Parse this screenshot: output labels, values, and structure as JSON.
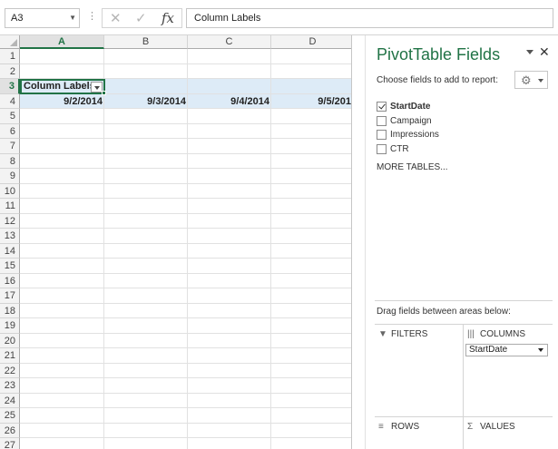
{
  "formula_bar": {
    "name_box": "A3",
    "dots": "⋮",
    "cancel_glyph": "✕",
    "enter_glyph": "✓",
    "fx_glyph": "fx",
    "formula": "Column Labels"
  },
  "grid": {
    "columns": [
      "A",
      "B",
      "C",
      "D"
    ],
    "rows": [
      "1",
      "2",
      "3",
      "4",
      "5",
      "6",
      "7",
      "8",
      "9",
      "10",
      "11",
      "12",
      "13",
      "14",
      "15",
      "16",
      "17",
      "18",
      "19",
      "20",
      "21",
      "22",
      "23",
      "24",
      "25",
      "26",
      "27"
    ],
    "pivot_header": "Column Labels",
    "dates": [
      "9/2/2014",
      "9/3/2014",
      "9/4/2014",
      "9/5/201"
    ]
  },
  "pane": {
    "title": "PivotTable Fields",
    "close_glyph": "✕",
    "choose_label": "Choose fields to add to report:",
    "gear_glyph": "⚙",
    "fields": [
      {
        "name": "StartDate",
        "checked": true
      },
      {
        "name": "Campaign",
        "checked": false
      },
      {
        "name": "Impressions",
        "checked": false
      },
      {
        "name": "CTR",
        "checked": false
      }
    ],
    "more_tables": "MORE TABLES...",
    "drag_label": "Drag fields between areas below:",
    "areas": {
      "filters": "FILTERS",
      "columns": "COLUMNS",
      "rows": "ROWS",
      "values": "VALUES",
      "filters_icon": "▼",
      "columns_icon": "|||",
      "rows_icon": "≡",
      "values_icon": "Σ"
    },
    "columns_item": "StartDate"
  }
}
